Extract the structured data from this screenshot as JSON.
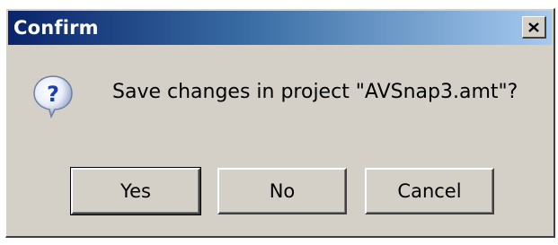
{
  "dialog": {
    "title": "Confirm",
    "close_glyph": "×",
    "icon": "question-icon",
    "message": "Save changes in project \"AVSnap3.amt\"?",
    "buttons": {
      "yes": "Yes",
      "no": "No",
      "cancel": "Cancel"
    }
  },
  "colors": {
    "title_gradient_start": "#0a246a",
    "title_gradient_end": "#a6caf0",
    "dialog_face": "#d4d0c8"
  }
}
